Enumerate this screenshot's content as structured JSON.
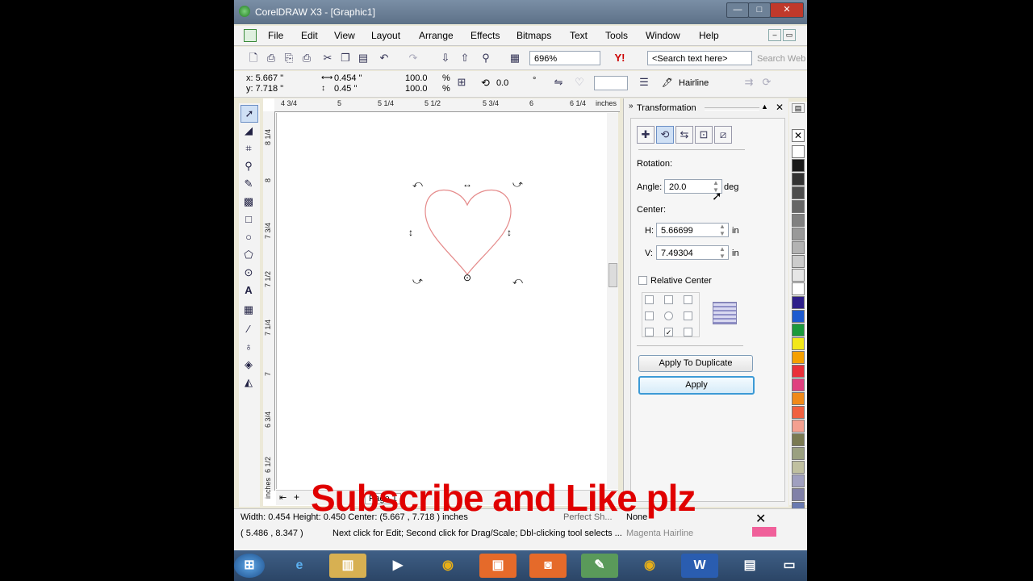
{
  "window": {
    "title": "CorelDRAW X3 - [Graphic1]",
    "controls": {
      "minimize": "—",
      "maximize": "□",
      "close": "✕"
    }
  },
  "menu": [
    "File",
    "Edit",
    "View",
    "Layout",
    "Arrange",
    "Effects",
    "Bitmaps",
    "Text",
    "Tools",
    "Window",
    "Help"
  ],
  "toolbar": {
    "zoom": "696%",
    "search_placeholder": "<Search text here>",
    "search_web": "Search Web"
  },
  "propbar": {
    "x": "x: 5.667 \"",
    "y": "y: 7.718 \"",
    "width": "0.454 \"",
    "height": "0.45 \"",
    "scale_x": "100.0",
    "scale_y": "100.0",
    "pct": "%",
    "rotation": "0.0",
    "deg_symbol": "°",
    "outline": "Hairline"
  },
  "rulers": {
    "h": [
      "4 3/4",
      "5",
      "5 1/4",
      "5 1/2",
      "5 3/4",
      "6",
      "6 1/4",
      "inches"
    ],
    "v": [
      "8 1/4",
      "8",
      "7 3/4",
      "7 1/2",
      "7 1/4",
      "7",
      "6 3/4",
      "6 1/2",
      "inches"
    ]
  },
  "docker": {
    "title": "Transformation",
    "rotation_label": "Rotation:",
    "angle_label": "Angle:",
    "angle_value": "20.0",
    "angle_unit": "deg",
    "center_label": "Center:",
    "h_label": "H:",
    "h_value": "5.66699",
    "v_label": "V:",
    "v_value": "7.49304",
    "unit": "in",
    "relative_center": "Relative Center",
    "apply_duplicate": "Apply To Duplicate",
    "apply": "Apply"
  },
  "page_tab": "Page 1",
  "status": {
    "dims": "Width: 0.454  Height: 0.450  Center: (5.667 , 7.718 )  inches",
    "coords": "( 5.486 , 8.347 )",
    "hint": "Next click for Edit; Second click for Drag/Scale; Dbl-clicking tool selects ...",
    "perfect": "Perfect Sh...",
    "none": "None",
    "magenta": "Magenta  Hairline"
  },
  "overlay_text": "Subscribe and Like plz",
  "palette": [
    "#ffffff",
    "#1a1a1a",
    "#333333",
    "#4d4d4d",
    "#666666",
    "#808080",
    "#999999",
    "#b3b3b3",
    "#cccccc",
    "#e6e6e6",
    "#ffffff",
    "#2e1f8a",
    "#1e5bd0",
    "#1b9a3c",
    "#f2e81a",
    "#f5a000",
    "#e9303a",
    "#e04080",
    "#f08a1a",
    "#f06040",
    "#f4a090",
    "#7a7a52",
    "#9aa080",
    "#c0c0a0",
    "#a0a0c0",
    "#8080a8",
    "#6a7ab0"
  ]
}
